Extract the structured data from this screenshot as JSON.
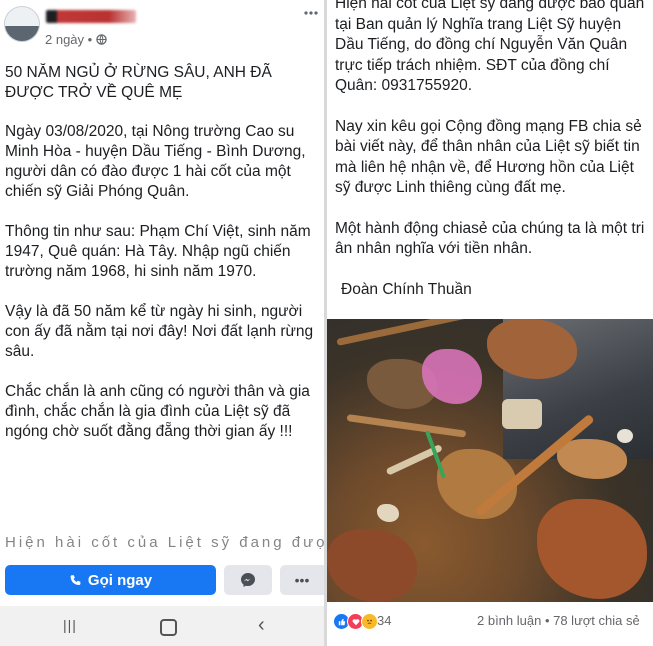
{
  "post_left": {
    "time": "2 ngày",
    "paragraphs": [
      "50 NĂM NGỦ Ở RỪNG SÂU, ANH ĐÃ ĐƯỢC TRỞ VỀ QUÊ MẸ",
      "Ngày 03/08/2020, tại Nông trường Cao su Minh Hòa - huyện Dầu Tiếng - Bình Dương, người dân có đào được 1 hài cốt của một chiến sỹ Giải Phóng Quân.",
      "Thông tin như sau: Phạm Chí Việt, sinh năm 1947, Quê quán: Hà Tây. Nhập ngũ chiến trường năm 1968, hi sinh năm 1970.",
      "Vậy là đã 50 năm kể từ ngày hi sinh, người con ấy đã nằm tại nơi đây! Nơi đất lạnh rừng sâu.",
      "Chắc chắn là anh cũng có người thân và gia đình, chắc chắn là gia đình của Liệt sỹ đã ngóng chờ suốt đằng đẵng thời gian ấy !!!"
    ],
    "truncated_line": "Hiện hài cốt của Liệt sỹ đang được bảo",
    "call_button": "Gọi ngay",
    "more_dots": "•••",
    "nav_recent": "|||",
    "nav_back": "‹"
  },
  "post_right": {
    "paragraphs": [
      "Hiện hài cốt của Liệt sỹ đang được bảo quản tại Ban quản lý Nghĩa trang Liệt Sỹ huyện Dầu Tiếng, do đồng chí Nguyễn Văn Quân trực tiếp trách nhiệm. SĐT của đồng chí Quân: 0931755920.",
      "Nay xin kêu gọi Cộng đồng mạng FB chia sẻ bài viết này, để thân nhân của Liệt sỹ biết tin mà liên hệ nhận về, để Hương hồn của Liệt sỹ được Linh thiêng cùng đất mẹ.",
      "Một hành động chiasẻ của chúng ta là một tri ân nhân nghĩa với tiền nhân.",
      "Đoàn Chính Thuần"
    ],
    "reaction_count": "34",
    "stats": "2 bình luận • 78 lượt chia sẻ"
  },
  "colors": {
    "facebook_blue": "#1877f2",
    "like_blue": "#1877f2",
    "love_red": "#f33e58",
    "haha_yellow": "#f7b928"
  },
  "icons": [
    "phone-icon",
    "messenger-icon",
    "globe-icon",
    "like-icon",
    "love-icon",
    "sad-icon",
    "home-icon",
    "back-icon"
  ]
}
